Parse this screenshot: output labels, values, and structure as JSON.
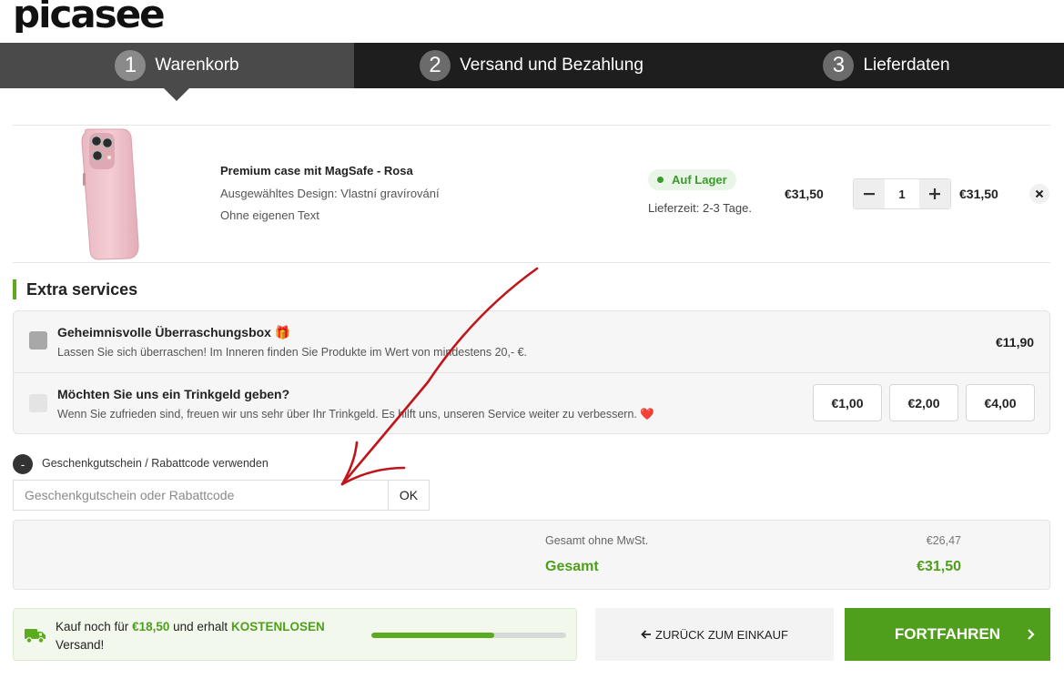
{
  "brand": {
    "logo_text": "picasee",
    "accent": "#5aab1f",
    "dark": "#1e1e1e"
  },
  "steps": [
    {
      "num": "1",
      "label": "Warenkorb",
      "active": true
    },
    {
      "num": "2",
      "label": "Versand und Bezahlung",
      "active": false
    },
    {
      "num": "3",
      "label": "Lieferdaten",
      "active": false
    }
  ],
  "cart_item": {
    "name": "Premium case mit MagSafe - Rosa",
    "design": "Ausgewähltes Design: Vlastní gravírování",
    "text": "Ohne eigenen Text",
    "stock": "Auf Lager",
    "delivery": "Lieferzeit: 2-3 Tage.",
    "unit_price": "€31,50",
    "quantity": "1",
    "total_price": "€31,50",
    "image_icon": "pink-phone-case",
    "remove_icon": "close-icon"
  },
  "extras": {
    "title": "Extra services",
    "surprise_box": {
      "title": "Geheimnisvolle Überraschungsbox",
      "title_emoji": "🎁",
      "desc": "Lassen Sie sich überraschen! Im Inneren finden Sie Produkte im Wert von mindestens 20,- €.",
      "price": "€11,90",
      "checked": true
    },
    "tip": {
      "title": "Möchten Sie uns ein Trinkgeld geben?",
      "desc": "Wenn Sie zufrieden sind, freuen wir uns sehr über Ihr Trinkgeld. Es hilft uns, unseren Service weiter zu verbessern.",
      "desc_emoji": "❤️",
      "checked": false,
      "options": [
        "€1,00",
        "€2,00",
        "€4,00"
      ]
    }
  },
  "coupon": {
    "toggle": "-",
    "label": "Geschenkgutschein / Rabattcode verwenden",
    "placeholder": "Geschenkgutschein oder Rabattcode",
    "ok_label": "OK"
  },
  "summary": {
    "net_label": "Gesamt ohne MwSt.",
    "net_value": "€26,47",
    "total_label": "Gesamt",
    "total_value": "€31,50"
  },
  "free_shipping": {
    "prefix": "Kauf noch für",
    "amount": "€18,50",
    "middle": "und erhalt",
    "highlight": "KOSTENLOSEN",
    "suffix": "Versand!",
    "progress": 0.63,
    "icon": "truck-icon"
  },
  "actions": {
    "back_label": "ZURÜCK ZUM EINKAUF",
    "back_icon": "arrow-left-icon",
    "continue_label": "FORTFAHREN",
    "continue_icon": "chevron-right-icon"
  }
}
